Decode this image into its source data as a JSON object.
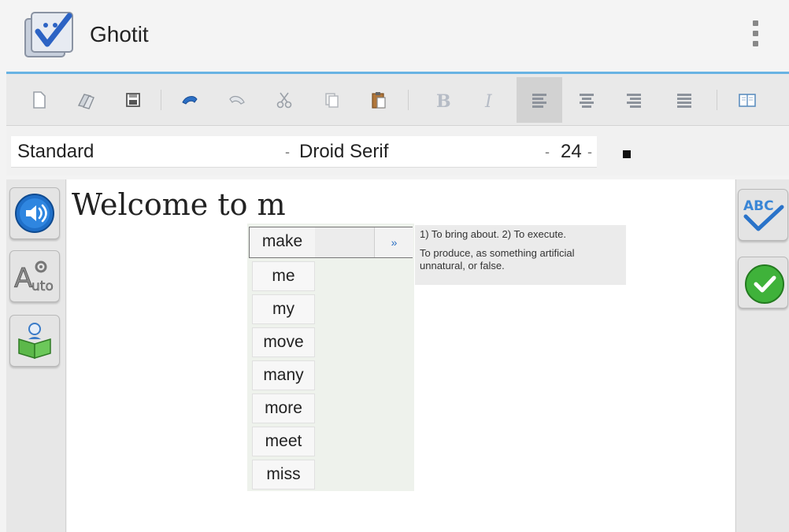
{
  "app": {
    "title": "Ghotit",
    "icon": "ghotit-logo-icon"
  },
  "toolbar": {
    "buttons": [
      {
        "name": "new-document-icon"
      },
      {
        "name": "open-file-icon"
      },
      {
        "name": "save-icon"
      },
      {
        "name": "undo-icon"
      },
      {
        "name": "redo-icon"
      },
      {
        "name": "cut-icon"
      },
      {
        "name": "copy-icon"
      },
      {
        "name": "paste-icon"
      },
      {
        "name": "bold-icon"
      },
      {
        "name": "italic-icon"
      },
      {
        "name": "align-left-icon",
        "active": true
      },
      {
        "name": "align-center-icon"
      },
      {
        "name": "align-right-icon"
      },
      {
        "name": "justify-icon"
      },
      {
        "name": "book-icon"
      }
    ]
  },
  "format": {
    "style_value": "Standard",
    "font_value": "Droid Serif",
    "size_value": "24",
    "dropdown_mark": "-",
    "text_color": "#111111"
  },
  "document": {
    "text": "Welcome to m"
  },
  "suggestions": {
    "items": [
      "make",
      "me",
      "my",
      "move",
      "many",
      "more",
      "meet",
      "miss"
    ],
    "expand_glyph": "»"
  },
  "definition": {
    "line1": "1) To bring about. 2) To execute.",
    "line2": "To produce, as something artificial unnatural, or false."
  },
  "colors": {
    "accent": "#69b3e3",
    "speaker_blue": "#1f6fc8",
    "check_green": "#3fb23a"
  }
}
